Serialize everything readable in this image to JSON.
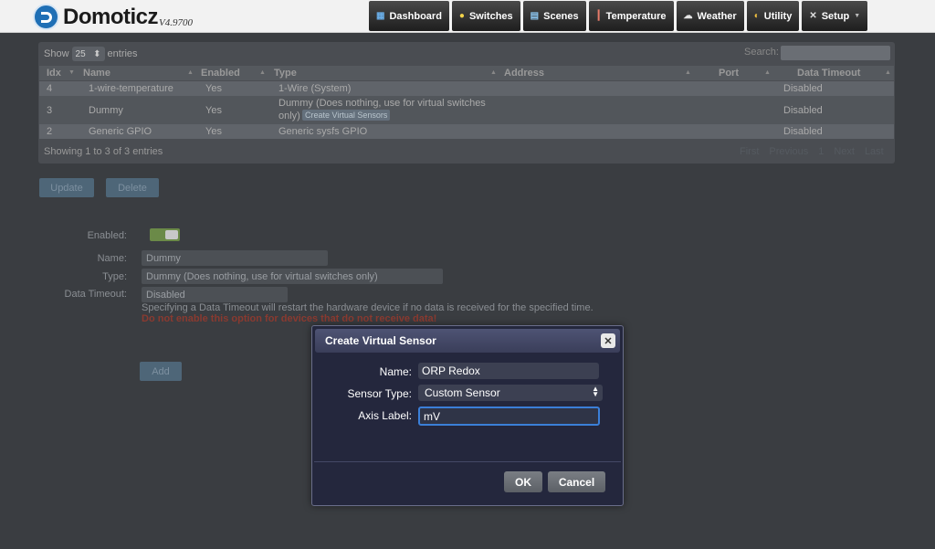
{
  "header": {
    "logo_text": "Domoticz",
    "version": "V4.9700",
    "nav": [
      {
        "label": "Dashboard",
        "icon": "dashboard-icon"
      },
      {
        "label": "Switches",
        "icon": "lightbulb-icon"
      },
      {
        "label": "Scenes",
        "icon": "scenes-icon"
      },
      {
        "label": "Temperature",
        "icon": "thermometer-icon"
      },
      {
        "label": "Weather",
        "icon": "cloud-icon"
      },
      {
        "label": "Utility",
        "icon": "utility-icon"
      },
      {
        "label": "Setup",
        "icon": "tools-icon"
      }
    ]
  },
  "table": {
    "show_label": "Show",
    "entries_value": "25",
    "entries_label": "entries",
    "search_label": "Search:",
    "columns": [
      "Idx",
      "Name",
      "Enabled",
      "Type",
      "Address",
      "Port",
      "Data Timeout"
    ],
    "rows": [
      {
        "idx": "4",
        "name": "1-wire-temperature",
        "enabled": "Yes",
        "type": "1-Wire (System)",
        "timeout": "Disabled"
      },
      {
        "idx": "3",
        "name": "Dummy",
        "enabled": "Yes",
        "type": "Dummy (Does nothing, use for virtual switches",
        "type2": "only)",
        "action": "Create Virtual Sensors",
        "timeout": "Disabled"
      },
      {
        "idx": "2",
        "name": "Generic GPIO",
        "enabled": "Yes",
        "type": "Generic sysfs GPIO",
        "timeout": "Disabled"
      }
    ],
    "showing": "Showing 1 to 3 of 3 entries",
    "pager": [
      "First",
      "Previous",
      "1",
      "Next",
      "Last"
    ]
  },
  "actions": {
    "update": "Update",
    "delete": "Delete",
    "add": "Add"
  },
  "form": {
    "enabled_label": "Enabled:",
    "name_label": "Name:",
    "name_value": "Dummy",
    "type_label": "Type:",
    "type_value": "Dummy (Does nothing, use for virtual switches only)",
    "timeout_label": "Data Timeout:",
    "timeout_value": "Disabled",
    "note": "Specifying a Data Timeout will restart the hardware device if no data is received for the specified time.",
    "warning": "Do not enable this option for devices that do not receive data!"
  },
  "modal": {
    "title": "Create Virtual Sensor",
    "name_label": "Name:",
    "name_value": "ORP Redox",
    "sensor_type_label": "Sensor Type:",
    "sensor_type_value": "Custom Sensor",
    "axis_label": "Axis Label:",
    "axis_value": "mV",
    "ok": "OK",
    "cancel": "Cancel"
  }
}
